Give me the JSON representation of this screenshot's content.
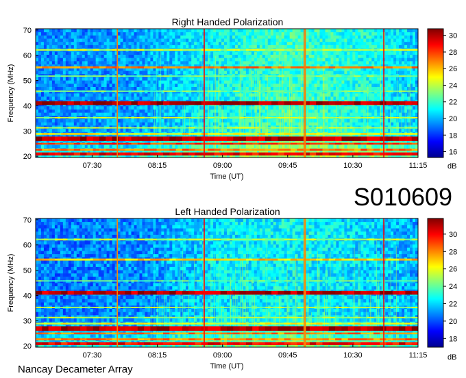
{
  "page": {
    "id_label": "S010609",
    "credit": "Nancay Decameter Array"
  },
  "chart_data": [
    {
      "type": "heatmap",
      "title": "Right Handed Polarization",
      "xlabel": "Time (UT)",
      "ylabel": "Frequency (MHz)",
      "x_ticks": [
        "07:30",
        "08:15",
        "09:00",
        "09:45",
        "10:30",
        "11:15"
      ],
      "x_tick_minutes": [
        450,
        495,
        540,
        585,
        630,
        675
      ],
      "xlim_minutes": [
        411,
        675
      ],
      "ylim": [
        19.5,
        70.5
      ],
      "y_ticks": [
        20,
        30,
        40,
        50,
        60,
        70
      ],
      "colorbar": {
        "label": "dB",
        "ticks": [
          16,
          18,
          20,
          22,
          24,
          26,
          28,
          30
        ],
        "range": [
          15.3,
          30.8
        ]
      },
      "background_level_db": 20.5,
      "time_levels_db": [
        [
          411,
          19.3
        ],
        [
          480,
          19.6
        ],
        [
          540,
          21.2
        ],
        [
          590,
          22.0
        ],
        [
          640,
          21.4
        ],
        [
          675,
          20.3
        ]
      ],
      "horizontal_bands": [
        {
          "freq": [
            20.3,
            21.5
          ],
          "db": 29
        },
        {
          "freq": [
            22.2,
            23.0
          ],
          "db": 27
        },
        {
          "freq": [
            24.6,
            25.3
          ],
          "db": 28
        },
        {
          "freq": [
            26.0,
            27.8
          ],
          "db": 30
        },
        {
          "freq": [
            28.5,
            29.2
          ],
          "db": 25
        },
        {
          "freq": [
            31.0,
            31.5
          ],
          "db": 24
        },
        {
          "freq": [
            35.0,
            35.5
          ],
          "db": 24
        },
        {
          "freq": [
            40.3,
            41.8
          ],
          "db": 30
        },
        {
          "freq": [
            45.5,
            46.0
          ],
          "db": 23
        },
        {
          "freq": [
            51.5,
            52.0
          ],
          "db": 23
        },
        {
          "freq": [
            54.8,
            55.6
          ],
          "db": 27
        },
        {
          "freq": [
            61.8,
            62.5
          ],
          "db": 24
        }
      ],
      "vertical_lines": [
        {
          "t": 467,
          "db": 27
        },
        {
          "t": 527,
          "db": 29
        },
        {
          "t": 596,
          "db": 27
        },
        {
          "t": 596.8,
          "db": 27
        },
        {
          "t": 651,
          "db": 29
        }
      ]
    },
    {
      "type": "heatmap",
      "title": "Left Handed Polarization",
      "xlabel": "Time (UT)",
      "ylabel": "Frequency (MHz)",
      "x_ticks": [
        "07:30",
        "08:15",
        "09:00",
        "09:45",
        "10:30",
        "11:15"
      ],
      "x_tick_minutes": [
        450,
        495,
        540,
        585,
        630,
        675
      ],
      "xlim_minutes": [
        411,
        675
      ],
      "ylim": [
        19.5,
        70.5
      ],
      "y_ticks": [
        20,
        30,
        40,
        50,
        60,
        70
      ],
      "colorbar": {
        "label": "dB",
        "ticks": [
          18,
          20,
          22,
          24,
          26,
          28,
          30
        ],
        "range": [
          17.0,
          31.8
        ]
      },
      "background_level_db": 21.5,
      "time_levels_db": [
        [
          411,
          20.6
        ],
        [
          480,
          20.8
        ],
        [
          540,
          22.3
        ],
        [
          590,
          22.6
        ],
        [
          640,
          22.0
        ],
        [
          675,
          21.3
        ]
      ],
      "horizontal_bands": [
        {
          "freq": [
            20.3,
            21.5
          ],
          "db": 30
        },
        {
          "freq": [
            22.2,
            23.0
          ],
          "db": 28
        },
        {
          "freq": [
            24.6,
            25.3
          ],
          "db": 28
        },
        {
          "freq": [
            26.0,
            27.8
          ],
          "db": 31
        },
        {
          "freq": [
            28.5,
            29.2
          ],
          "db": 26
        },
        {
          "freq": [
            31.0,
            31.5
          ],
          "db": 25
        },
        {
          "freq": [
            35.0,
            35.5
          ],
          "db": 25
        },
        {
          "freq": [
            40.3,
            41.8
          ],
          "db": 31
        },
        {
          "freq": [
            45.5,
            46.0
          ],
          "db": 24
        },
        {
          "freq": [
            53.8,
            54.6
          ],
          "db": 27
        },
        {
          "freq": [
            61.8,
            62.5
          ],
          "db": 25
        }
      ],
      "vertical_lines": [
        {
          "t": 467,
          "db": 28
        },
        {
          "t": 527,
          "db": 30
        },
        {
          "t": 596,
          "db": 28
        },
        {
          "t": 596.8,
          "db": 28
        },
        {
          "t": 651,
          "db": 30
        }
      ]
    }
  ]
}
